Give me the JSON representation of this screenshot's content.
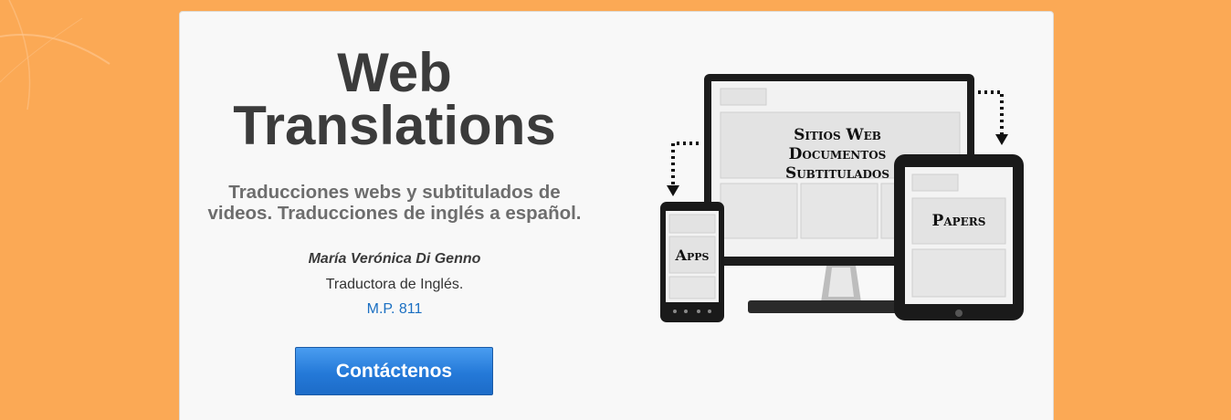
{
  "hero": {
    "title_line1": "Web",
    "title_line2": "Translations",
    "tagline_line1": "Traducciones webs y subtitulados de",
    "tagline_line2": "videos. Traducciones de inglés a español."
  },
  "author": {
    "name": "María Verónica Di Genno",
    "role": "Traductora de Inglés.",
    "license": "M.P. 811"
  },
  "cta": {
    "label": "Contáctenos"
  },
  "illustration": {
    "monitor_line1": "Sitios Web",
    "monitor_line2": "Documentos",
    "monitor_line3": "Subtitulados",
    "phone_label": "Apps",
    "tablet_label": "Papers"
  },
  "colors": {
    "background": "#fba955",
    "card": "#f8f8f8",
    "button": "#2479d8",
    "link": "#1a6fc2"
  }
}
